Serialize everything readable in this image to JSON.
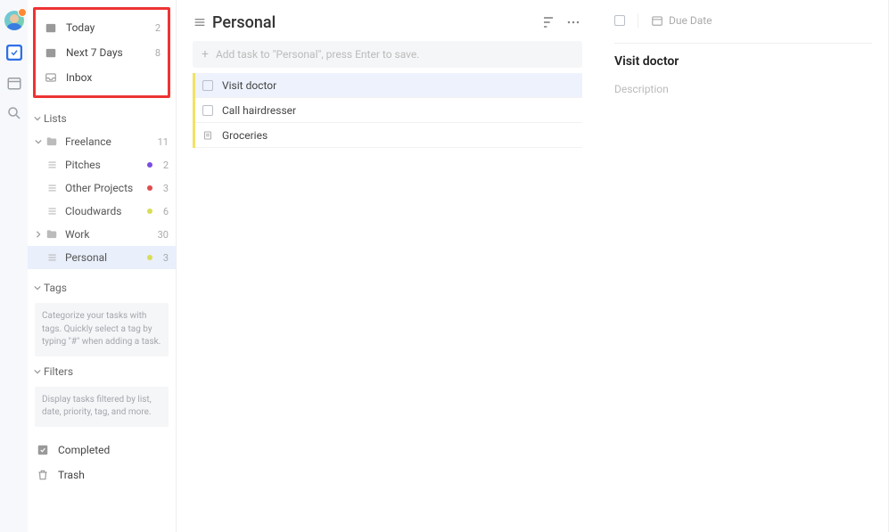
{
  "smart": {
    "today": {
      "label": "Today",
      "count": 2
    },
    "next7": {
      "label": "Next 7 Days",
      "count": 8
    },
    "inbox": {
      "label": "Inbox"
    }
  },
  "sections": {
    "lists": "Lists",
    "tags": "Tags",
    "filters": "Filters"
  },
  "lists": {
    "freelance": {
      "label": "Freelance",
      "count": 11
    },
    "pitches": {
      "label": "Pitches",
      "count": 2,
      "dot": "#7a4ce0"
    },
    "other": {
      "label": "Other Projects",
      "count": 3,
      "dot": "#e04c4c"
    },
    "cloudwards": {
      "label": "Cloudwards",
      "count": 6,
      "dot": "#d8dd57"
    },
    "work": {
      "label": "Work",
      "count": 30
    },
    "personal": {
      "label": "Personal",
      "count": 3,
      "dot": "#d8dd57"
    }
  },
  "tags_help": "Categorize your tasks with tags. Quickly select a tag by typing \"#\" when adding a task.",
  "filters_help": "Display tasks filtered by list, date, priority, tag, and more.",
  "bottom": {
    "completed": "Completed",
    "trash": "Trash"
  },
  "main": {
    "title": "Personal",
    "add_placeholder": "Add task to \"Personal\", press Enter to save.",
    "tasks": {
      "t0": {
        "title": "Visit doctor",
        "type": "task"
      },
      "t1": {
        "title": "Call hairdresser",
        "type": "task"
      },
      "t2": {
        "title": "Groceries",
        "type": "note"
      }
    }
  },
  "detail": {
    "due_label": "Due Date",
    "title": "Visit doctor",
    "desc_placeholder": "Description"
  }
}
